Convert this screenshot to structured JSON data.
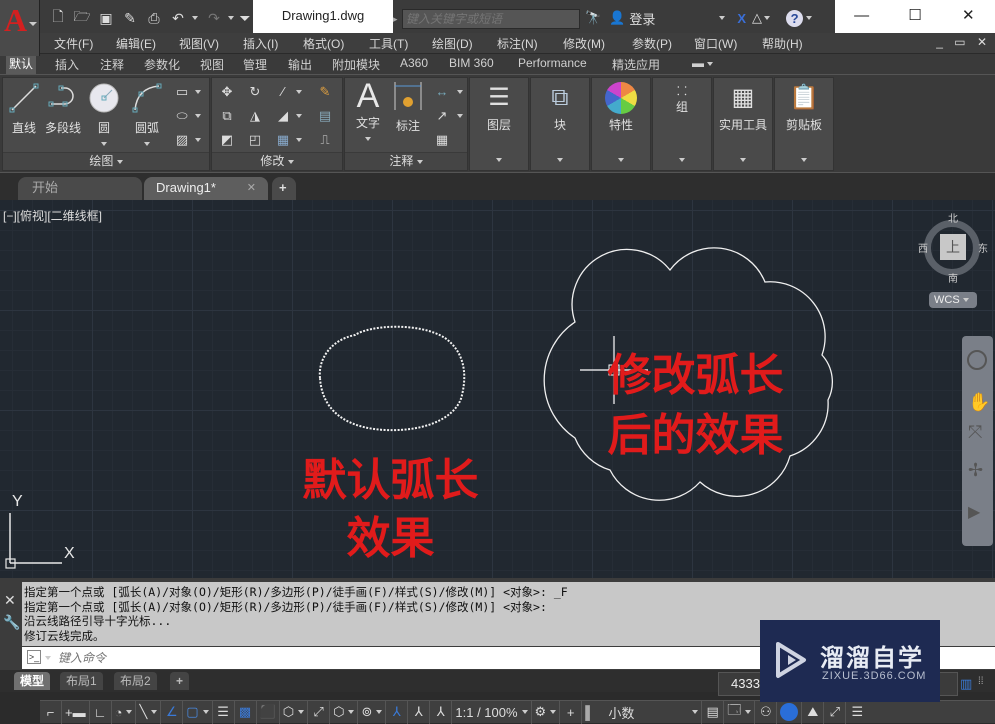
{
  "titlebar": {
    "document_title": "Drawing1.dwg",
    "search_placeholder": "键入关键字或短语",
    "sign_in_label": "登录",
    "quick_access": [
      "new-icon",
      "open-icon",
      "save-icon",
      "save-as-icon",
      "print-icon",
      "undo-icon",
      "redo-icon",
      "customize-icon"
    ],
    "window_controls": {
      "minimize": "—",
      "maximize": "☐",
      "close": "✕"
    }
  },
  "menubar": {
    "items": [
      "文件(F)",
      "编辑(E)",
      "视图(V)",
      "插入(I)",
      "格式(O)",
      "工具(T)",
      "绘图(D)",
      "标注(N)",
      "修改(M)",
      "参数(P)",
      "窗口(W)",
      "帮助(H)"
    ],
    "mdi_controls": "_ ▭ ✕"
  },
  "ribbon_tabs": {
    "active": "默认",
    "items": [
      "默认",
      "插入",
      "注释",
      "参数化",
      "视图",
      "管理",
      "输出",
      "附加模块",
      "A360",
      "BIM 360",
      "Performance",
      "精选应用"
    ]
  },
  "ribbon": {
    "draw_panel": {
      "title": "绘图",
      "buttons": [
        "直线",
        "多段线",
        "圆",
        "圆弧"
      ]
    },
    "modify_panel": {
      "title": "修改"
    },
    "annotation_panel": {
      "title": "注释",
      "buttons": [
        "文字",
        "标注"
      ]
    },
    "panels": [
      "图层",
      "块",
      "特性",
      "组",
      "实用工具",
      "剪贴板"
    ]
  },
  "file_tabs": {
    "items": [
      "开始",
      "Drawing1*"
    ],
    "active": "Drawing1*",
    "add_label": "+"
  },
  "canvas": {
    "viewport_label": "[−][俯视][二维线框]",
    "annotation_default": [
      "默认弧长",
      "效果"
    ],
    "annotation_modified": [
      "修改弧长",
      "后的效果"
    ],
    "text_color": "#e11b1b",
    "ucs_x": "X",
    "ucs_y": "Y"
  },
  "viewcube": {
    "north": "北",
    "south": "南",
    "east": "东",
    "west": "西",
    "face": "上",
    "wcs_label": "WCS"
  },
  "command_line": {
    "history": [
      "指定第一个点或 [弧长(A)/对象(O)/矩形(R)/多边形(P)/徒手画(F)/样式(S)/修改(M)] <对象>: _F",
      "指定第一个点或 [弧长(A)/对象(O)/矩形(R)/多边形(P)/徒手画(F)/样式(S)/修改(M)] <对象>:",
      "沿云线路径引导十字光标...",
      "修订云线完成。"
    ],
    "input_placeholder": "键入命令"
  },
  "layout_tabs": {
    "items": [
      "模型",
      "布局1",
      "布局2"
    ],
    "active": "模型",
    "add_label": "+"
  },
  "statusbar": {
    "coordinates": "4333",
    "annotation_scale": "1:1 / 100%",
    "units": "小数"
  },
  "watermark": {
    "title": "溜溜自学",
    "url": "ZIXUE.3D66.COM"
  }
}
